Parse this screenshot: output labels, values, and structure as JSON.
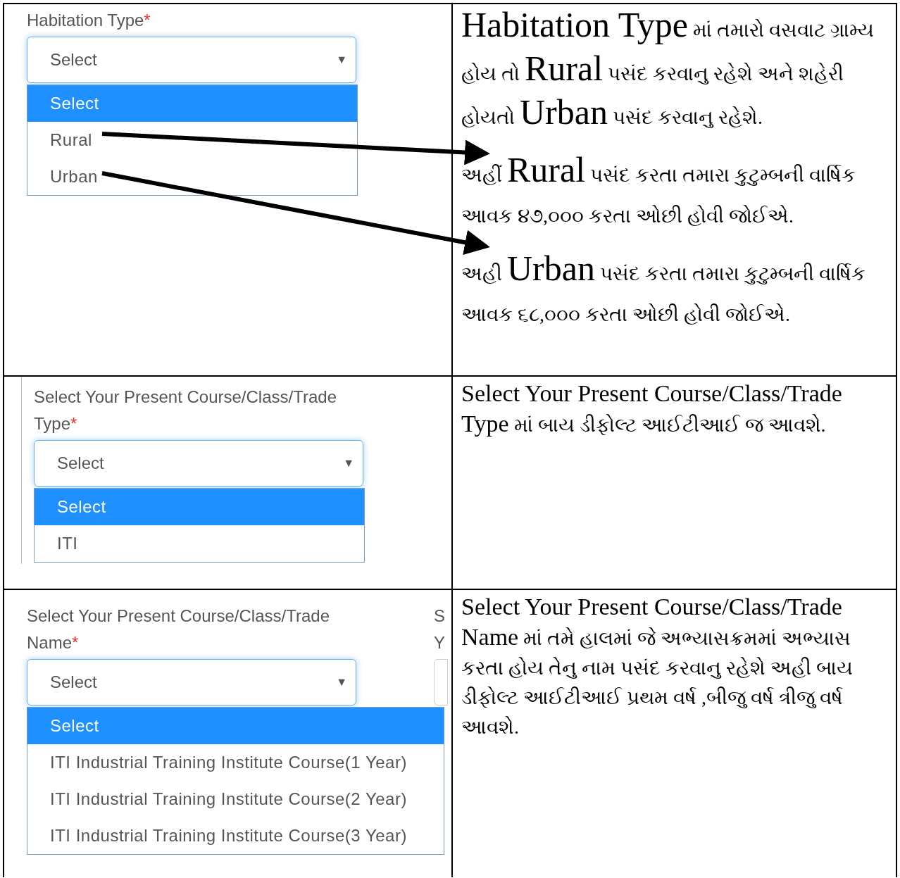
{
  "rows": [
    {
      "form": {
        "label": "Habitation Type",
        "asterisk": "*",
        "value": "Select",
        "caret": "▼",
        "list_wide": false,
        "options": [
          {
            "label": "Select",
            "selected": true
          },
          {
            "label": "Rural",
            "selected": false
          },
          {
            "label": "Urban",
            "selected": false
          }
        ]
      },
      "paragraphs": [
        [
          {
            "text": "Habitation Type",
            "kind": "large"
          },
          {
            "text": " માં તમારો વસવાટ ગ્રામ્ય હોય તો ",
            "kind": "plain"
          },
          {
            "text": "Rural",
            "kind": "large"
          },
          {
            "text": " પસંદ કરવાનુ રહેશે અને શહેરી હોયતો ",
            "kind": "plain"
          },
          {
            "text": "Urban",
            "kind": "large"
          },
          {
            "text": " પસંદ કરવાનુ રહેશે.",
            "kind": "plain"
          }
        ],
        [
          {
            "text": "અહીં ",
            "kind": "plain"
          },
          {
            "text": "Rural",
            "kind": "large"
          },
          {
            "text": " પસંદ કરતા તમારા કુટુમ્બની વાર્ષિક આવક ૪૭,૦૦૦ કરતા ઓછી હોવી જોઈએ.",
            "kind": "plain"
          }
        ],
        [
          {
            "text": "અહી ",
            "kind": "plain"
          },
          {
            "text": "Urban",
            "kind": "large"
          },
          {
            "text": " પસંદ કરતા તમારા કુટુમ્બની વાર્ષિક આવક ૬૮,૦૦૦ કરતા ઓછી હોવી જોઈએ.",
            "kind": "plain"
          }
        ]
      ]
    },
    {
      "form": {
        "label": "Select Your Present Course/Class/Trade Type",
        "asterisk": "*",
        "value": "Select",
        "caret": "▼",
        "list_wide": false,
        "options": [
          {
            "label": "Select",
            "selected": true
          },
          {
            "label": "ITI",
            "selected": false
          }
        ]
      },
      "paragraphs": [
        [
          {
            "text": "Select Your Present Course/Class/Trade Type",
            "kind": "medium"
          },
          {
            "text": " માં બાય ડીફોલ્ટ આઈટીઆઈ જ આવશે.",
            "kind": "plain"
          }
        ]
      ]
    },
    {
      "form": {
        "label": "Select Your Present Course/Class/Trade Name",
        "asterisk": "*",
        "value": "Select",
        "caret": "▼",
        "list_wide": true,
        "side_label": [
          "S",
          "Y"
        ],
        "options": [
          {
            "label": "Select",
            "selected": true
          },
          {
            "label": "ITI Industrial Training Institute Course(1 Year)",
            "selected": false
          },
          {
            "label": "ITI Industrial Training Institute Course(2 Year)",
            "selected": false
          },
          {
            "label": "ITI Industrial Training Institute Course(3 Year)",
            "selected": false
          }
        ]
      },
      "paragraphs": [
        [
          {
            "text": "Select Your Present Course/Class/Trade Name",
            "kind": "medium"
          },
          {
            "text": " માં તમે હાલમાં જે અભ્યાસક્રમમાં અભ્યાસ કરતા હોય તેનુ નામ પસંદ કરવાનુ રહેશે અહી બાય ડીફોલ્ટ આઈટીઆઈ પ્રથમ વર્ષ ,બીજુ વર્ષ ત્રીજુ વર્ષ આવશે.",
            "kind": "plain"
          }
        ]
      ]
    }
  ]
}
